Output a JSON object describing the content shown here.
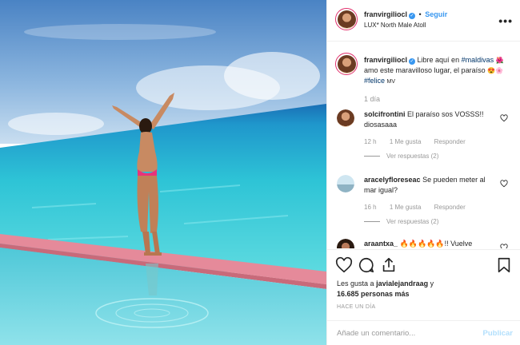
{
  "post": {
    "username": "franvirgiliocl",
    "verified_mark": "✓",
    "follow_separator": "•",
    "follow_label": "Seguir",
    "location": "LUX* North Male Atoll",
    "more_icon": "more-options-icon"
  },
  "caption": {
    "username": "franvirgiliocl",
    "text_1": "Libre aquí en",
    "tag_1": "#maldivas",
    "emoji_1": "🌺",
    "text_2": "amo este maravilloso lugar, el paraíso",
    "emoji_2": "😍🌸",
    "tag_2": "#felice",
    "tail": "MV",
    "time": "1 día"
  },
  "comments": [
    {
      "username": "solcifrontini",
      "text": "El paraíso sos VOSSS!! diosasaaa",
      "time": "12 h",
      "likes": "1 Me gusta",
      "reply": "Responder",
      "view_replies": "Ver respuestas (2)"
    },
    {
      "username": "aracelyfloreseac",
      "text": "Se pueden meter al mar igual?",
      "time": "16 h",
      "likes": "1 Me gusta",
      "reply": "Responder",
      "view_replies": "Ver respuestas (2)"
    },
    {
      "username": "araantxa_",
      "text": "🔥🔥🔥🔥🔥!! Vuelve"
    }
  ],
  "actions": {
    "likes_prefix": "Les gusta a",
    "likes_user": "javialejandraag",
    "likes_and": "y",
    "likes_count": "16.685 personas más",
    "ago": "HACE UN DÍA",
    "comment_placeholder": "Añade un comentario...",
    "publish_label": "Publicar"
  },
  "colors": {
    "link": "#3897f0",
    "sea": "#2ec4d6",
    "pool_edge": "#e58a9a"
  }
}
